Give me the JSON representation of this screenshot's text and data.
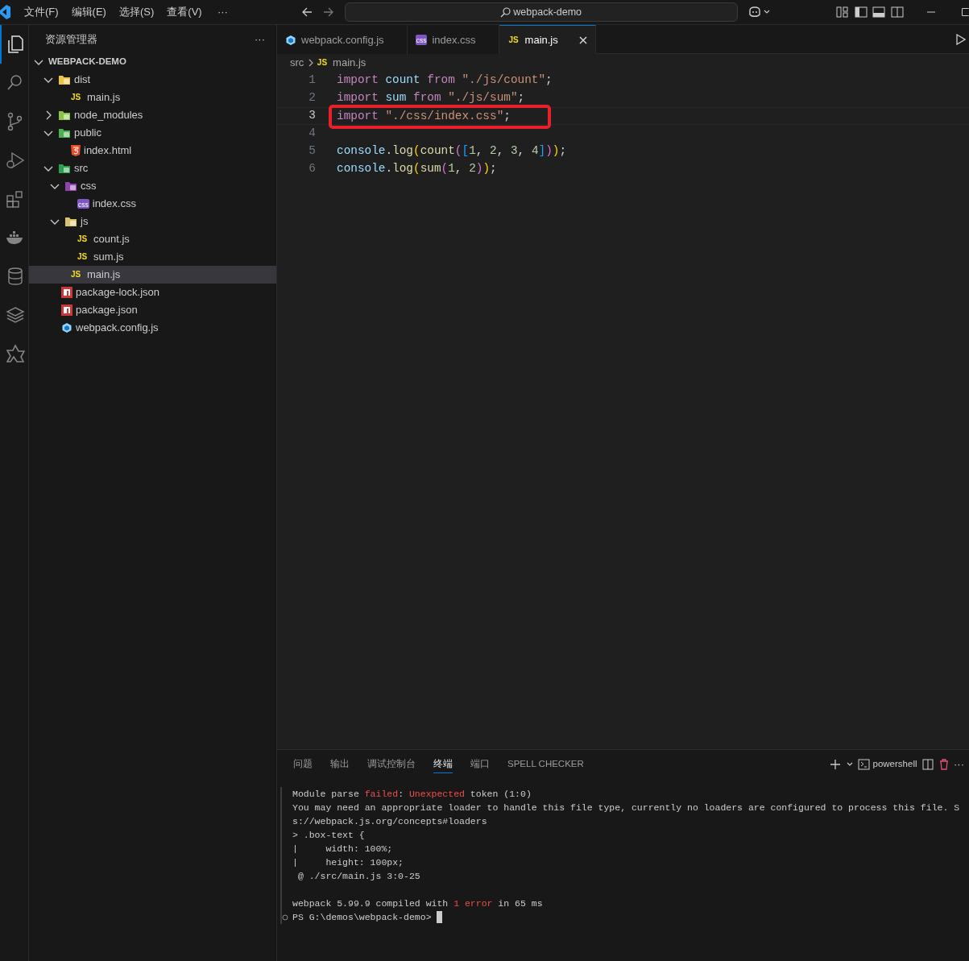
{
  "menu_bar": {
    "items": [
      "文件(F)",
      "编辑(E)",
      "选择(S)",
      "查看(V)"
    ],
    "more": "···"
  },
  "command_center": {
    "text": "webpack-demo"
  },
  "activity_bar": [
    {
      "kind": "explorer",
      "selected": true
    },
    {
      "kind": "search",
      "selected": false
    },
    {
      "kind": "source-control",
      "selected": false
    },
    {
      "kind": "debug",
      "selected": false
    },
    {
      "kind": "extensions",
      "selected": false
    },
    {
      "kind": "docker",
      "selected": false
    },
    {
      "kind": "database",
      "selected": false
    },
    {
      "kind": "layers",
      "selected": false
    },
    {
      "kind": "puzzle",
      "selected": false
    }
  ],
  "explorer": {
    "title": "资源管理器",
    "more": "···",
    "root": {
      "label": "WEBPACK-DEMO",
      "expanded": true
    },
    "tree": [
      {
        "label": "dist",
        "kind": "folder",
        "color": "#e8c547",
        "expanded": true,
        "selected": false,
        "children": [
          {
            "label": "main.js",
            "kind": "js",
            "badge": "JS",
            "selected": false
          }
        ]
      },
      {
        "label": "node_modules",
        "kind": "folder",
        "color": "#8bc34a",
        "expanded": false,
        "selected": false
      },
      {
        "label": "public",
        "kind": "folder",
        "color": "#4caf50",
        "expanded": true,
        "selected": false,
        "children": [
          {
            "label": "index.html",
            "kind": "html",
            "selected": false
          }
        ]
      },
      {
        "label": "src",
        "kind": "folder",
        "color": "#2e9e4f",
        "expanded": true,
        "selected": false,
        "children": [
          {
            "label": "css",
            "kind": "folder",
            "color": "#8e44ad",
            "expanded": true,
            "selected": false,
            "children": [
              {
                "label": "index.css",
                "kind": "css",
                "badge": "css",
                "selected": false
              }
            ]
          },
          {
            "label": "js",
            "kind": "folder",
            "color": "#d9c36a",
            "expanded": true,
            "selected": false,
            "children": [
              {
                "label": "count.js",
                "kind": "js",
                "badge": "JS",
                "selected": false
              },
              {
                "label": "sum.js",
                "kind": "js",
                "badge": "JS",
                "selected": false
              }
            ]
          },
          {
            "label": "main.js",
            "kind": "js",
            "badge": "JS",
            "selected": true
          }
        ]
      },
      {
        "label": "package-lock.json",
        "kind": "npm",
        "selected": false
      },
      {
        "label": "package.json",
        "kind": "npm",
        "selected": false
      },
      {
        "label": "webpack.config.js",
        "kind": "webpack",
        "selected": false
      }
    ]
  },
  "tabs": [
    {
      "label": "webpack.config.js",
      "kind": "webpack",
      "selected": false
    },
    {
      "label": "index.css",
      "kind": "css",
      "badge": "css",
      "selected": false
    },
    {
      "label": "main.js",
      "kind": "js",
      "badge": "JS",
      "selected": true
    }
  ],
  "breadcrumb": [
    {
      "label": "src",
      "kind": "folder"
    },
    {
      "label": "main.js",
      "kind": "js",
      "badge": "JS"
    }
  ],
  "code": [
    {
      "number": "1",
      "current": false,
      "highlighted": false,
      "tokens": [
        {
          "text": "import ",
          "kind": "keyword"
        },
        {
          "text": "count ",
          "kind": "var"
        },
        {
          "text": "from ",
          "kind": "keyword"
        },
        {
          "text": "\"./js/count\"",
          "kind": "string"
        },
        {
          "text": ";",
          "kind": "plain"
        }
      ]
    },
    {
      "number": "2",
      "current": false,
      "highlighted": false,
      "tokens": [
        {
          "text": "import ",
          "kind": "keyword"
        },
        {
          "text": "sum ",
          "kind": "var"
        },
        {
          "text": "from ",
          "kind": "keyword"
        },
        {
          "text": "\"./js/sum\"",
          "kind": "string"
        },
        {
          "text": ";",
          "kind": "plain"
        }
      ]
    },
    {
      "number": "3",
      "current": true,
      "highlighted": true,
      "tokens": [
        {
          "text": "import ",
          "kind": "keyword"
        },
        {
          "text": "\"./css/index.css\"",
          "kind": "string"
        },
        {
          "text": ";",
          "kind": "plain"
        }
      ]
    },
    {
      "number": "4",
      "current": false,
      "highlighted": false
    },
    {
      "number": "5",
      "current": false,
      "highlighted": false,
      "tokens": [
        {
          "text": "console",
          "kind": "var"
        },
        {
          "text": ".",
          "kind": "plain"
        },
        {
          "text": "log",
          "kind": "func"
        },
        {
          "text": "(",
          "kind": "bracket1"
        },
        {
          "text": "count",
          "kind": "func"
        },
        {
          "text": "(",
          "kind": "bracket2"
        },
        {
          "text": "[",
          "kind": "bracket3"
        },
        {
          "text": "1",
          "kind": "number"
        },
        {
          "text": ", ",
          "kind": "plain"
        },
        {
          "text": "2",
          "kind": "number"
        },
        {
          "text": ", ",
          "kind": "plain"
        },
        {
          "text": "3",
          "kind": "number"
        },
        {
          "text": ", ",
          "kind": "plain"
        },
        {
          "text": "4",
          "kind": "number"
        },
        {
          "text": "]",
          "kind": "bracket3"
        },
        {
          "text": ")",
          "kind": "bracket2"
        },
        {
          "text": ")",
          "kind": "bracket1"
        },
        {
          "text": ";",
          "kind": "plain"
        }
      ]
    },
    {
      "number": "6",
      "current": false,
      "highlighted": false,
      "tokens": [
        {
          "text": "console",
          "kind": "var"
        },
        {
          "text": ".",
          "kind": "plain"
        },
        {
          "text": "log",
          "kind": "func"
        },
        {
          "text": "(",
          "kind": "bracket1"
        },
        {
          "text": "sum",
          "kind": "func"
        },
        {
          "text": "(",
          "kind": "bracket2"
        },
        {
          "text": "1",
          "kind": "number"
        },
        {
          "text": ", ",
          "kind": "plain"
        },
        {
          "text": "2",
          "kind": "number"
        },
        {
          "text": ")",
          "kind": "bracket2"
        },
        {
          "text": ")",
          "kind": "bracket1"
        },
        {
          "text": ";",
          "kind": "plain"
        }
      ]
    }
  ],
  "panel": {
    "tabs": [
      {
        "label": "问题",
        "selected": false
      },
      {
        "label": "输出",
        "selected": false
      },
      {
        "label": "调试控制台",
        "selected": false
      },
      {
        "label": "终端",
        "selected": true
      },
      {
        "label": "端口",
        "selected": false
      },
      {
        "label": "SPELL CHECKER",
        "selected": false
      }
    ],
    "shell": "powershell",
    "terminal": [
      {
        "kind": "output",
        "spaced": false,
        "segments": [
          {
            "text": "Module parse ",
            "kind": "plain"
          },
          {
            "text": "failed",
            "kind": "error"
          },
          {
            "text": ": ",
            "kind": "plain"
          },
          {
            "text": "Unexpected",
            "kind": "error"
          },
          {
            "text": " token (1:0)",
            "kind": "plain"
          }
        ]
      },
      {
        "kind": "output",
        "spaced": false,
        "segments": [
          {
            "text": "You may need an appropriate loader to handle this file type, currently no loaders are configured to process this file. S",
            "kind": "plain"
          }
        ]
      },
      {
        "kind": "output",
        "spaced": false,
        "segments": [
          {
            "text": "s://webpack.js.org/concepts#loaders",
            "kind": "plain"
          }
        ]
      },
      {
        "kind": "output",
        "spaced": false,
        "segments": [
          {
            "text": "> .box-text {",
            "kind": "plain"
          }
        ]
      },
      {
        "kind": "output",
        "spaced": false,
        "segments": [
          {
            "text": "|     width: 100%;",
            "kind": "plain"
          }
        ]
      },
      {
        "kind": "output",
        "spaced": false,
        "segments": [
          {
            "text": "|     height: 100px;",
            "kind": "plain"
          }
        ]
      },
      {
        "kind": "output",
        "spaced": false,
        "segments": [
          {
            "text": " @ ./src/main.js 3:0-25",
            "kind": "plain"
          }
        ]
      },
      {
        "kind": "output",
        "spaced": true,
        "segments": [
          {
            "text": "webpack 5.99.9 compiled with ",
            "kind": "plain"
          },
          {
            "text": "1 error",
            "kind": "error"
          },
          {
            "text": " in 65 ms",
            "kind": "plain"
          }
        ]
      },
      {
        "kind": "prompt",
        "spaced": false,
        "segments": [
          {
            "text": "PS G:\\demos\\webpack-demo>",
            "kind": "plain"
          }
        ]
      }
    ]
  }
}
